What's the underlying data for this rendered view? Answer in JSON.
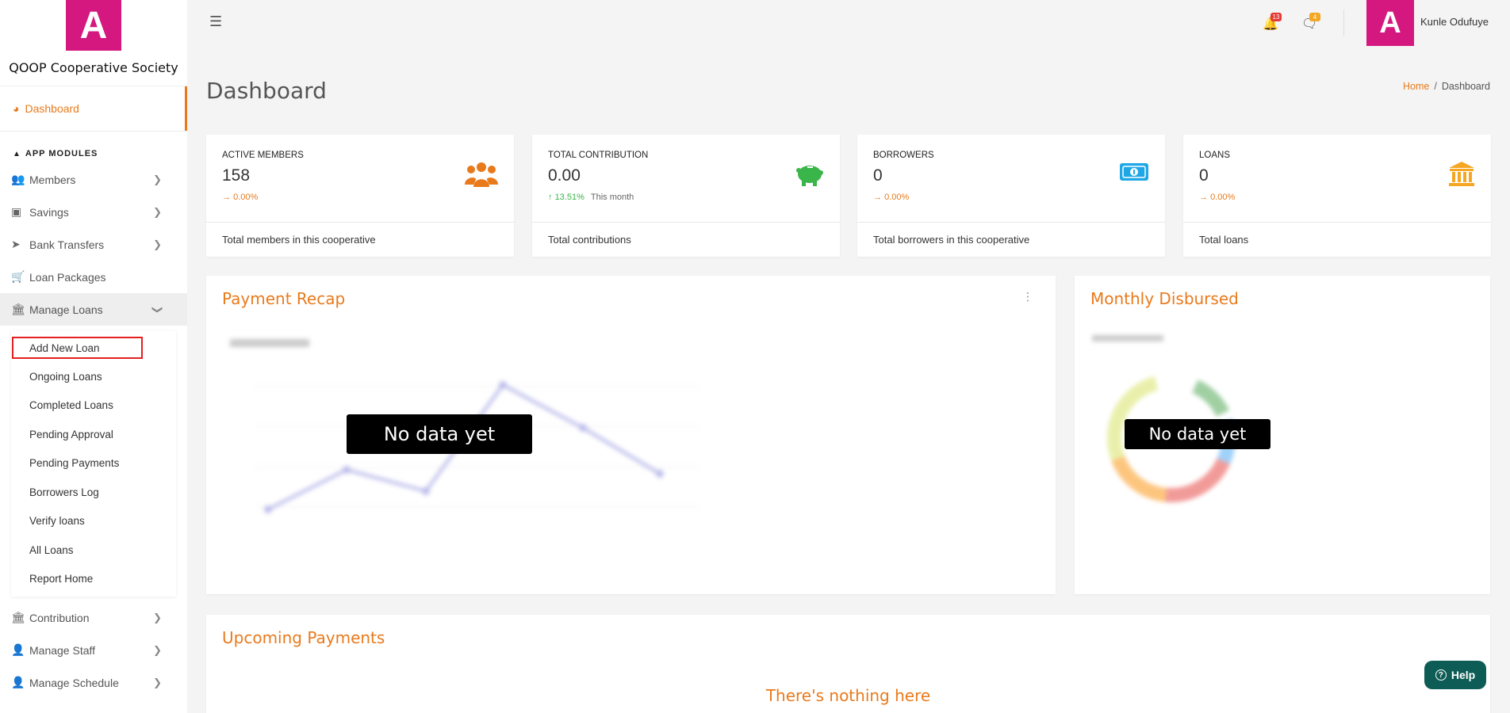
{
  "brand": {
    "logo_letter": "A",
    "name": "QOOP Cooperative Society",
    "logo_color": "#d41880"
  },
  "sidebar": {
    "dashboard_label": "Dashboard",
    "section_label": "APP MODULES",
    "items": [
      {
        "label": "Members",
        "icon": "users-icon"
      },
      {
        "label": "Savings",
        "icon": "money-icon"
      },
      {
        "label": "Bank Transfers",
        "icon": "paper-plane-icon"
      },
      {
        "label": "Loan Packages",
        "icon": "cart-icon"
      },
      {
        "label": "Manage Loans",
        "icon": "bank-icon"
      }
    ],
    "loan_submenu": [
      "Add New Loan",
      "Ongoing Loans",
      "Completed Loans",
      "Pending Approval",
      "Pending Payments",
      "Borrowers Log",
      "Verify loans",
      "All Loans",
      "Report Home"
    ],
    "items_after": [
      {
        "label": "Contribution",
        "icon": "bank-icon"
      },
      {
        "label": "Manage Staff",
        "icon": "user-icon"
      },
      {
        "label": "Manage Schedule",
        "icon": "user-icon"
      }
    ]
  },
  "topbar": {
    "notifications_count": "13",
    "messages_count": "4",
    "user_initial": "A",
    "user_name": "Kunle Odufuye"
  },
  "page": {
    "title": "Dashboard",
    "breadcrumb_home": "Home",
    "breadcrumb_sep": "/",
    "breadcrumb_current": "Dashboard"
  },
  "stats": [
    {
      "label": "ACTIVE MEMBERS",
      "value": "158",
      "trend": "0.00%",
      "trend_note": "",
      "footer": "Total members in this cooperative",
      "icon": "users-icon",
      "icon_color": "#e97a1c"
    },
    {
      "label": "TOTAL CONTRIBUTION",
      "value": "0.00",
      "trend": "13.51%",
      "trend_note": "This month",
      "footer": "Total contributions",
      "icon": "piggy-bank-icon",
      "icon_color": "#3ab54a"
    },
    {
      "label": "BORROWERS",
      "value": "0",
      "trend": "0.00%",
      "trend_note": "",
      "footer": "Total borrowers in this cooperative",
      "icon": "money-bill-icon",
      "icon_color": "#1ea7e6"
    },
    {
      "label": "LOANS",
      "value": "0",
      "trend": "0.00%",
      "trend_note": "",
      "footer": "Total loans",
      "icon": "bank-icon",
      "icon_color": "#f5a623"
    }
  ],
  "panels": {
    "payment_recap_title": "Payment Recap",
    "monthly_disbursed_title": "Monthly Disbursed",
    "no_data": "No data yet",
    "upcoming_title": "Upcoming Payments",
    "nothing_here": "There's nothing here"
  },
  "help_label": "Help",
  "colors": {
    "accent": "#e97a1c",
    "brand": "#d41880",
    "help": "#0d5c56"
  }
}
